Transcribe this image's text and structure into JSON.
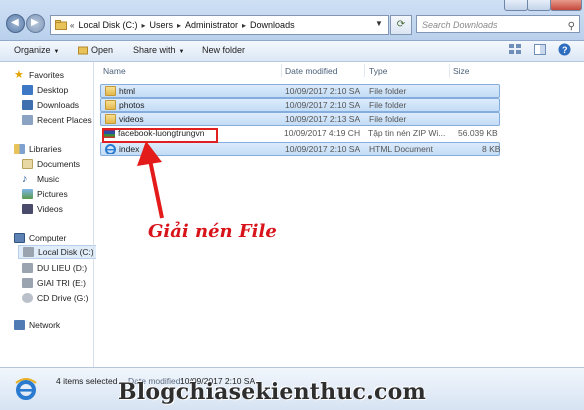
{
  "address_bar": {
    "chevron": "«",
    "crumbs": [
      "Local Disk (C:)",
      "Users",
      "Administrator",
      "Downloads"
    ],
    "separator": "▸"
  },
  "search": {
    "placeholder": "Search Downloads",
    "icon": "search-icon"
  },
  "toolbar": {
    "organize": "Organize",
    "open": "Open",
    "share_with": "Share with",
    "new_folder": "New folder"
  },
  "nav": {
    "favorites": "Favorites",
    "desktop": "Desktop",
    "downloads": "Downloads",
    "recent_places": "Recent Places",
    "libraries": "Libraries",
    "documents": "Documents",
    "music": "Music",
    "pictures": "Pictures",
    "videos": "Videos",
    "computer": "Computer",
    "local_disk": "Local Disk (C:)",
    "du_lieu": "DU LIEU (D:)",
    "giai_tri": "GIAI TRI (E:)",
    "cd_drive": "CD Drive (G:)",
    "network": "Network"
  },
  "columns": {
    "name": "Name",
    "date_modified": "Date modified",
    "type": "Type",
    "size": "Size"
  },
  "files": [
    {
      "name": "html",
      "date": "10/09/2017 2:10 SA",
      "type": "File folder",
      "size": "",
      "icon": "folder-icon",
      "selected": true
    },
    {
      "name": "photos",
      "date": "10/09/2017 2:10 SA",
      "type": "File folder",
      "size": "",
      "icon": "folder-icon",
      "selected": true
    },
    {
      "name": "videos",
      "date": "10/09/2017 2:13 SA",
      "type": "File folder",
      "size": "",
      "icon": "folder-icon",
      "selected": true
    },
    {
      "name": "facebook-luongtrungvn",
      "date": "10/09/2017 4:19 CH",
      "type": "Tập tin nén ZIP Wi...",
      "size": "56.039 KB",
      "icon": "zip-archive-icon",
      "selected": false
    },
    {
      "name": "index",
      "date": "10/09/2017 2:10 SA",
      "type": "HTML Document",
      "size": "8 KB",
      "icon": "html-document-icon",
      "selected": true
    }
  ],
  "annotation": {
    "text": "Giải nén File",
    "color": "#d8141a"
  },
  "details": {
    "selection": "4 items selected",
    "date_label": "Date modified:",
    "date_value": "10/09/2017 2:10 SA"
  },
  "watermark": "Blogchiasekienthuc.com"
}
